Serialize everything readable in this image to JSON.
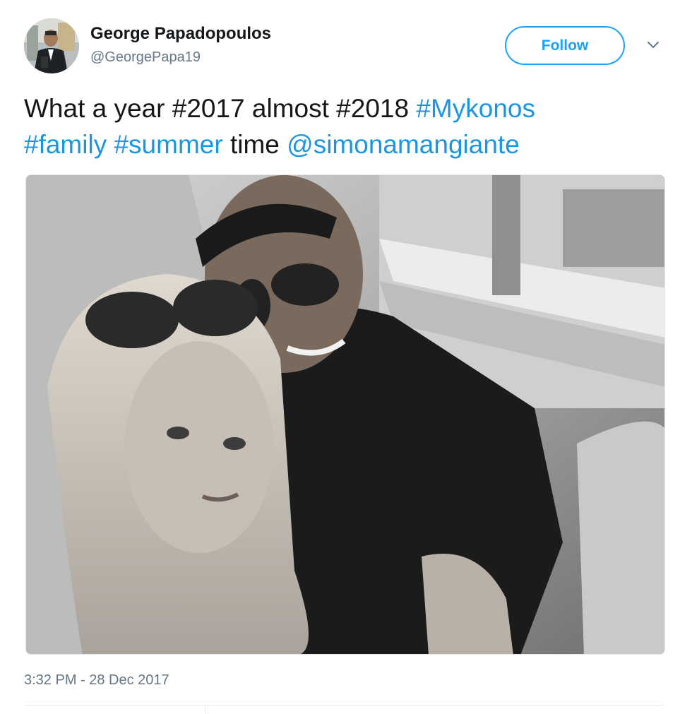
{
  "user": {
    "display_name": "George Papadopoulos",
    "handle": "@GeorgePapa19"
  },
  "follow_button": {
    "label": "Follow"
  },
  "tweet": {
    "segments_line1": [
      {
        "text": "What a year #2017 almost #2018 ",
        "link": false
      },
      {
        "text": "#Mykonos",
        "link": true
      }
    ],
    "segments_line2": [
      {
        "text": "#family",
        "link": true
      },
      {
        "text": " ",
        "link": false
      },
      {
        "text": "#summer",
        "link": true
      },
      {
        "text": " time ",
        "link": false
      },
      {
        "text": "@simonamangiante",
        "link": true
      }
    ],
    "timestamp": "3:32 PM - 28 Dec 2017"
  },
  "colors": {
    "link": "#1b95e0",
    "follow_accent": "#1da1f2",
    "secondary_text": "#657786",
    "primary_text": "#14171a"
  },
  "icons": {
    "menu_caret": "chevron-down-icon"
  }
}
